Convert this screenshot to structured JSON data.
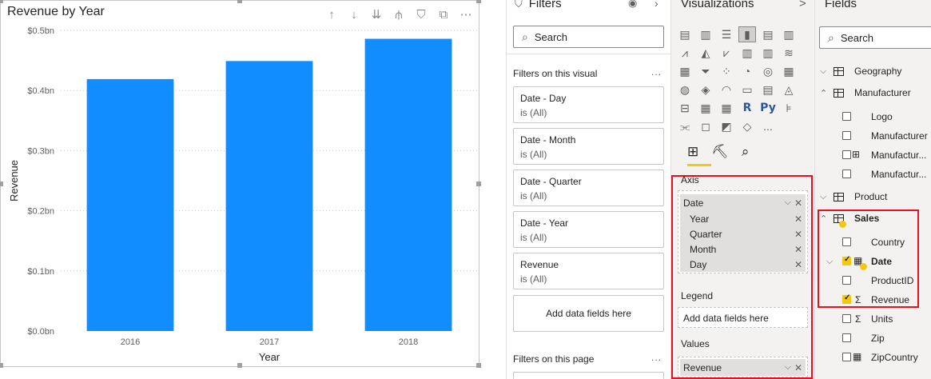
{
  "visual": {
    "title": "Revenue by Year",
    "header_icons": [
      "arrow-up-icon",
      "arrow-down-icon",
      "double-arrow-down-icon",
      "expand-hierarchy-icon",
      "filter-icon",
      "focus-mode-icon",
      "more-options-icon"
    ]
  },
  "chart_data": {
    "type": "bar",
    "categories": [
      "2016",
      "2017",
      "2018"
    ],
    "values": [
      0.419,
      0.449,
      0.486
    ],
    "xlabel": "Year",
    "ylabel": "Revenue",
    "ylim": [
      0,
      0.5
    ],
    "yticks": [
      "$0.0bn",
      "$0.1bn",
      "$0.2bn",
      "$0.3bn",
      "$0.4bn",
      "$0.5bn"
    ],
    "color": "#118dff",
    "grid": true
  },
  "filters": {
    "title": "Filters",
    "search_placeholder": "Search",
    "on_visual_label": "Filters on this visual",
    "more": "...",
    "cards": [
      {
        "name": "Date - Day",
        "value": "is (All)"
      },
      {
        "name": "Date - Month",
        "value": "is (All)"
      },
      {
        "name": "Date - Quarter",
        "value": "is (All)"
      },
      {
        "name": "Date - Year",
        "value": "is (All)"
      },
      {
        "name": "Revenue",
        "value": "is (All)"
      }
    ],
    "add_fields": "Add data fields here",
    "on_page_label": "Filters on this page"
  },
  "viz": {
    "title": "Visualizations",
    "chevron": ">",
    "r_label": "R",
    "py_label": "Py",
    "more": "...",
    "axis_label": "Axis",
    "axis_fields": [
      "Date",
      "Year",
      "Quarter",
      "Month",
      "Day"
    ],
    "legend_label": "Legend",
    "legend_placeholder": "Add data fields here",
    "values_label": "Values",
    "values_field": "Revenue"
  },
  "fields": {
    "title": "Fields",
    "search_placeholder": "Search",
    "items": [
      {
        "label": "Geography"
      },
      {
        "label": "Manufacturer"
      },
      {
        "label": "Logo"
      },
      {
        "label": "Manufacturer"
      },
      {
        "label": "Manufactur..."
      },
      {
        "label": "Manufactur..."
      },
      {
        "label": "Product"
      },
      {
        "label": "Sales"
      },
      {
        "label": "Country"
      },
      {
        "label": "Date"
      },
      {
        "label": "ProductID"
      },
      {
        "label": "Revenue"
      },
      {
        "label": "Units"
      },
      {
        "label": "Zip"
      },
      {
        "label": "ZipCountry"
      }
    ]
  },
  "colors": {
    "accent": "#f2c811",
    "bar": "#118dff",
    "highlight_box": "#e81123"
  }
}
